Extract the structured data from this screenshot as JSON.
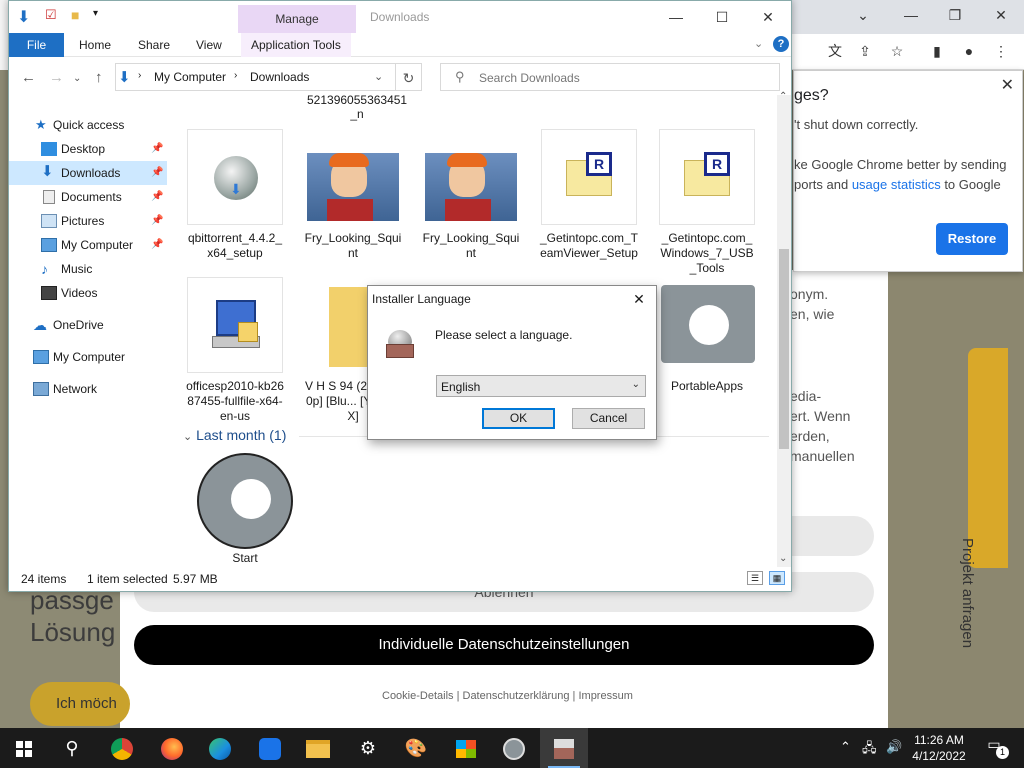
{
  "explorer": {
    "manage_tab": "Manage",
    "title": "Downloads",
    "ribbon_tabs": [
      "File",
      "Home",
      "Share",
      "View",
      "Application Tools"
    ],
    "address": {
      "root": "My Computer",
      "folder": "Downloads"
    },
    "search_placeholder": "Search Downloads",
    "sidebar": [
      {
        "label": "Quick access"
      },
      {
        "label": "Desktop"
      },
      {
        "label": "Downloads"
      },
      {
        "label": "Documents"
      },
      {
        "label": "Pictures"
      },
      {
        "label": "My Computer"
      },
      {
        "label": "Music"
      },
      {
        "label": "Videos"
      },
      {
        "label": "OneDrive"
      },
      {
        "label": "My Computer"
      },
      {
        "label": "Network"
      }
    ],
    "top_partial_name": "521396055363451 _n",
    "files_row1": [
      {
        "name": "qbittorrent_4.4.2_x64_setup"
      },
      {
        "name": "Fry_Looking_Squint"
      },
      {
        "name": "Fry_Looking_Squint"
      },
      {
        "name": "_Getintopc.com_TeamViewer_Setup"
      },
      {
        "name": "_Getintopc.com_Windows_7_USB_Tools"
      }
    ],
    "files_row2": [
      {
        "name": "officesp2010-kb2687455-fullfile-x64-en-us"
      },
      {
        "name": "V H S 94 (2...) [720p] [Blu... [YTS.MX]"
      },
      {
        "name": "PortableApps"
      }
    ],
    "group_header": "Last month (1)",
    "files_row3": [
      {
        "name": "Start"
      }
    ],
    "status": {
      "items": "24 items",
      "selected": "1 item selected",
      "size": "5.97 MB"
    }
  },
  "dialog": {
    "title": "Installer Language",
    "message": "Please select a language.",
    "selected_language": "English",
    "ok": "OK",
    "cancel": "Cancel"
  },
  "chrome_popup": {
    "title": "ges?",
    "line1": "'t shut down correctly.",
    "line2": "ke Google Chrome better by sending",
    "line3a": "ports and ",
    "line3link": "usage statistics",
    "line3b": " to Google",
    "restore": "Restore"
  },
  "website": {
    "text1": "onym.",
    "text2": "en, wie",
    "text3": "edia-",
    "text4": "ert. Wenn",
    "text5": "erden,",
    "text6": "manuellen",
    "vertical_button": "Projekt anfragen",
    "big1": "passge",
    "big2": "Lösung",
    "ablehnen": "Ablehnen",
    "main_button": "Individuelle Datenschutzeinstellungen",
    "footer": "Cookie-Details | Datenschutzerklärung | Impressum",
    "ich": "Ich möch"
  },
  "taskbar": {
    "time": "11:26 AM",
    "date": "4/12/2022",
    "notification_count": "1"
  }
}
